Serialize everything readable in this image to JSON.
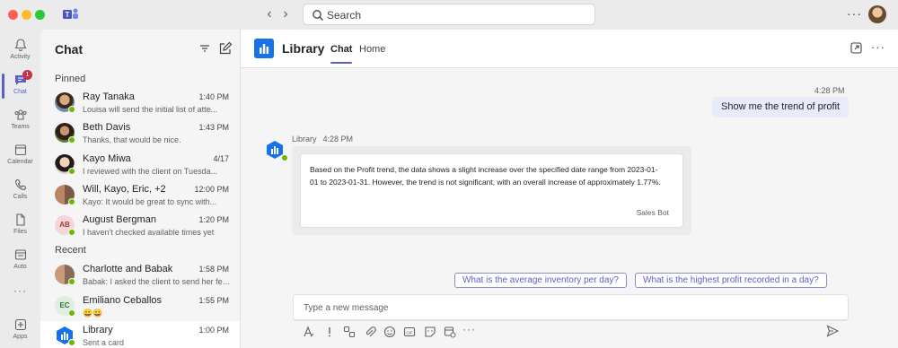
{
  "titlebar": {
    "search_placeholder": "Search",
    "more": "···"
  },
  "rail": {
    "items": [
      {
        "label": "Activity",
        "icon": "bell-icon"
      },
      {
        "label": "Chat",
        "icon": "chat-icon",
        "badge": "1"
      },
      {
        "label": "Teams",
        "icon": "teams-icon"
      },
      {
        "label": "Calendar",
        "icon": "calendar-icon"
      },
      {
        "label": "Calls",
        "icon": "phone-icon"
      },
      {
        "label": "Files",
        "icon": "file-icon"
      },
      {
        "label": "Auto",
        "icon": "auto-icon"
      },
      {
        "label": "···",
        "icon": "more-icon"
      },
      {
        "label": "Apps",
        "icon": "apps-icon"
      }
    ]
  },
  "chatlist": {
    "title": "Chat",
    "pinned_label": "Pinned",
    "recent_label": "Recent",
    "pinned": [
      {
        "name": "Ray Tanaka",
        "time": "1:40 PM",
        "preview": "Louisa will send the initial list of atte..."
      },
      {
        "name": "Beth Davis",
        "time": "1:43 PM",
        "preview": "Thanks, that would be nice."
      },
      {
        "name": "Kayo Miwa",
        "time": "4/17",
        "preview": "I reviewed with the client on Tuesda..."
      },
      {
        "name": "Will, Kayo, Eric, +2",
        "time": "12:00 PM",
        "preview": "Kayo: It would be great to sync with..."
      },
      {
        "name": "August Bergman",
        "time": "1:20 PM",
        "preview": "I haven't checked available times yet",
        "initials": "AB"
      }
    ],
    "recent": [
      {
        "name": "Charlotte and Babak",
        "time": "1:58 PM",
        "preview": "Babak: I asked the client to send her feed..."
      },
      {
        "name": "Emiliano Ceballos",
        "time": "1:55 PM",
        "preview": "😀😀",
        "initials": "EC"
      },
      {
        "name": "Library",
        "time": "1:00 PM",
        "preview": "Sent a card"
      }
    ]
  },
  "main": {
    "title": "Library",
    "tabs": [
      "Chat",
      "Home"
    ],
    "more": "···",
    "outgoing": {
      "time": "4:28 PM",
      "text": "Show me the trend of profit"
    },
    "incoming": {
      "sender": "Library",
      "time": "4:28 PM",
      "card_text": "Based on the Profit trend, the data shows a slight increase over the specified date range from 2023-01-01 to 2023-01-31. However, the trend is not significant, with an overall increase of approximately 1.77%.",
      "card_footer": "Sales Bot"
    },
    "suggestions": [
      "What is the average inventory per day?",
      "What is the highest profit recorded in a day?"
    ],
    "composer_placeholder": "Type a new message",
    "toolbar_more": "···"
  },
  "colors": {
    "accent": "#5b5fc7",
    "presence": "#6bb700",
    "badge": "#c4314b",
    "app_blue": "#1672e8"
  }
}
